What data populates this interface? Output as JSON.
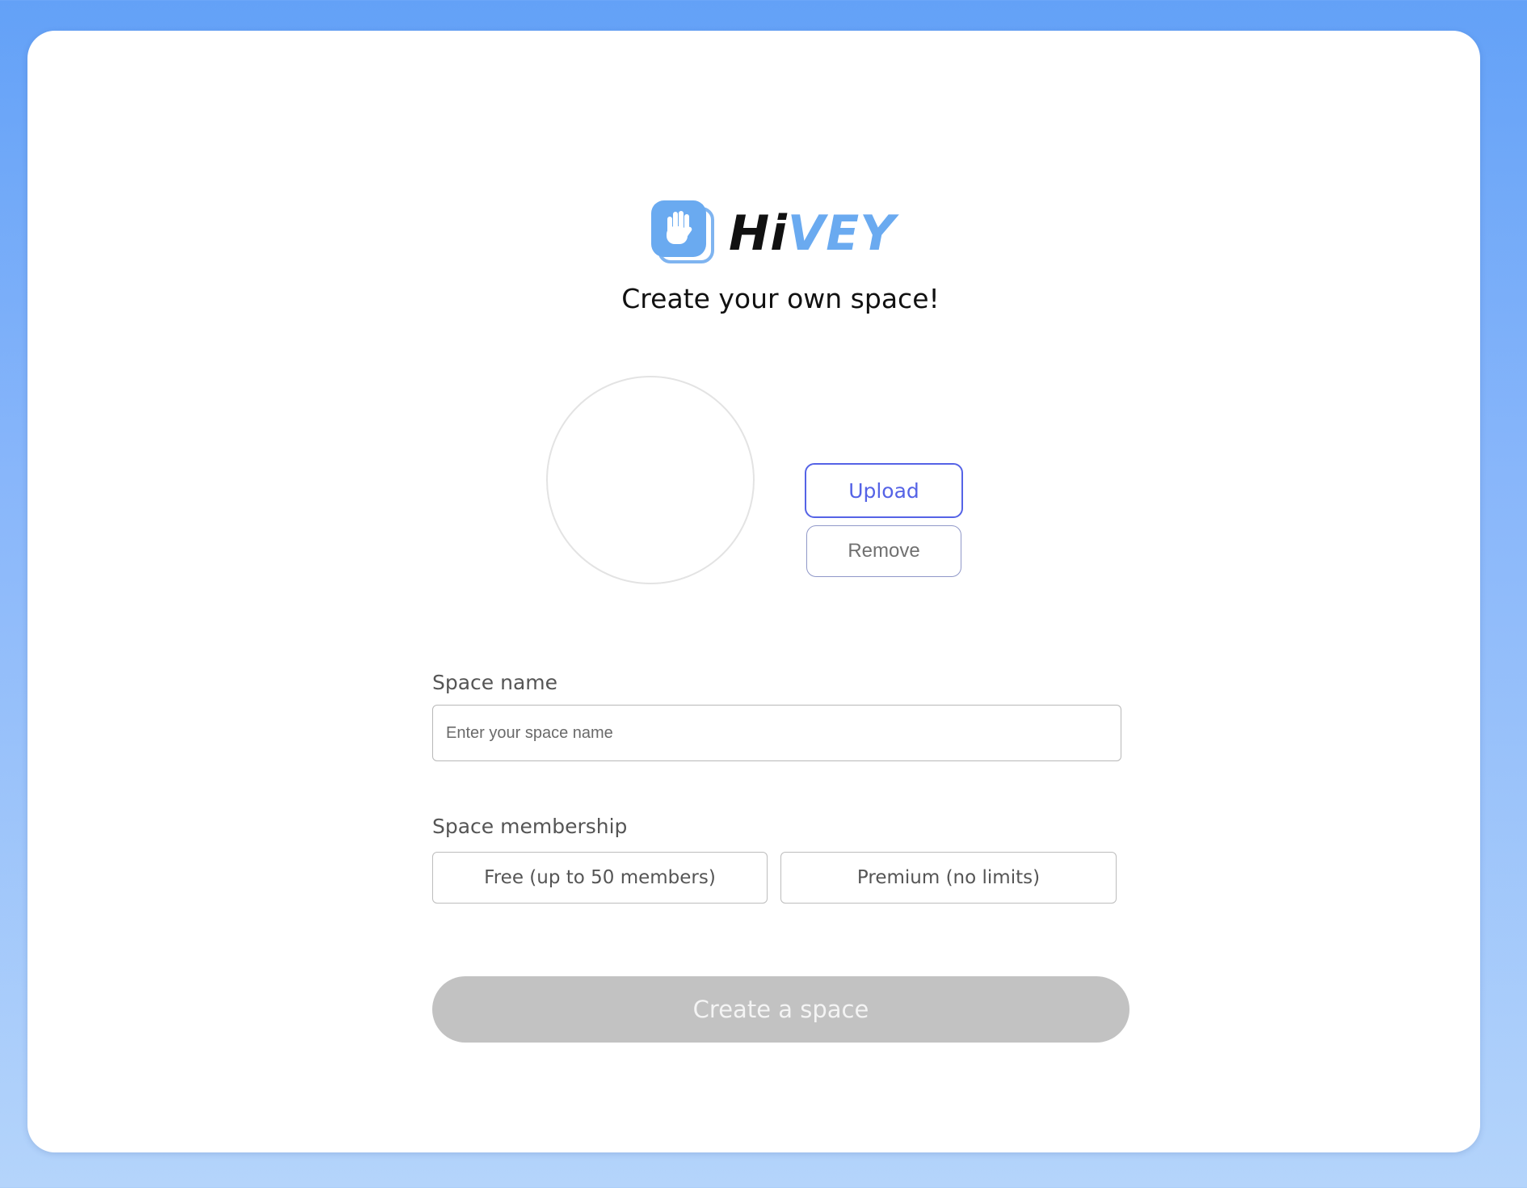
{
  "brand": {
    "name_part1": "Hi",
    "name_part2": "VEY",
    "logo_icon": "waving-hand-icon",
    "accent_color": "#6aaaf0"
  },
  "headline": "Create your own space!",
  "avatar": {
    "upload_label": "Upload",
    "remove_label": "Remove"
  },
  "space_name": {
    "label": "Space name",
    "value": "",
    "placeholder": "Enter your space name"
  },
  "membership": {
    "label": "Space membership",
    "options": [
      {
        "label": "Free (up to 50 members)"
      },
      {
        "label": "Premium (no limits)"
      }
    ]
  },
  "submit": {
    "label": "Create a space",
    "state": "disabled"
  },
  "colors": {
    "background_top": "#63a1f7",
    "background_bottom": "#b4d4fb",
    "upload_border": "#5563e6",
    "submit_disabled": "#c2c2c2"
  }
}
